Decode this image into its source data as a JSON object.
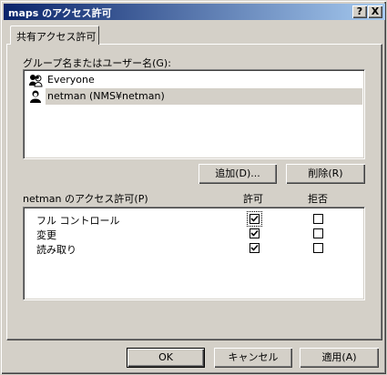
{
  "window": {
    "title": "maps のアクセス許可",
    "help_label": "?",
    "close_label": "X"
  },
  "tab": {
    "label": "共有アクセス許可"
  },
  "group_section": {
    "label": "グループ名またはユーザー名(G):",
    "users": [
      {
        "name": "Everyone",
        "icon": "users-group-icon"
      },
      {
        "name": "netman (NMS¥netman)",
        "icon": "user-icon",
        "selected": true
      }
    ],
    "add_label": "追加(D)...",
    "remove_label": "削除(R)"
  },
  "permissions": {
    "label": "netman のアクセス許可(P)",
    "allow_header": "許可",
    "deny_header": "拒否",
    "rows": [
      {
        "name": "フル コントロール",
        "allow": true,
        "deny": false
      },
      {
        "name": "変更",
        "allow": true,
        "deny": false
      },
      {
        "name": "読み取り",
        "allow": true,
        "deny": false
      }
    ]
  },
  "footer": {
    "ok_label": "OK",
    "cancel_label": "キャンセル",
    "apply_label": "適用(A)"
  }
}
